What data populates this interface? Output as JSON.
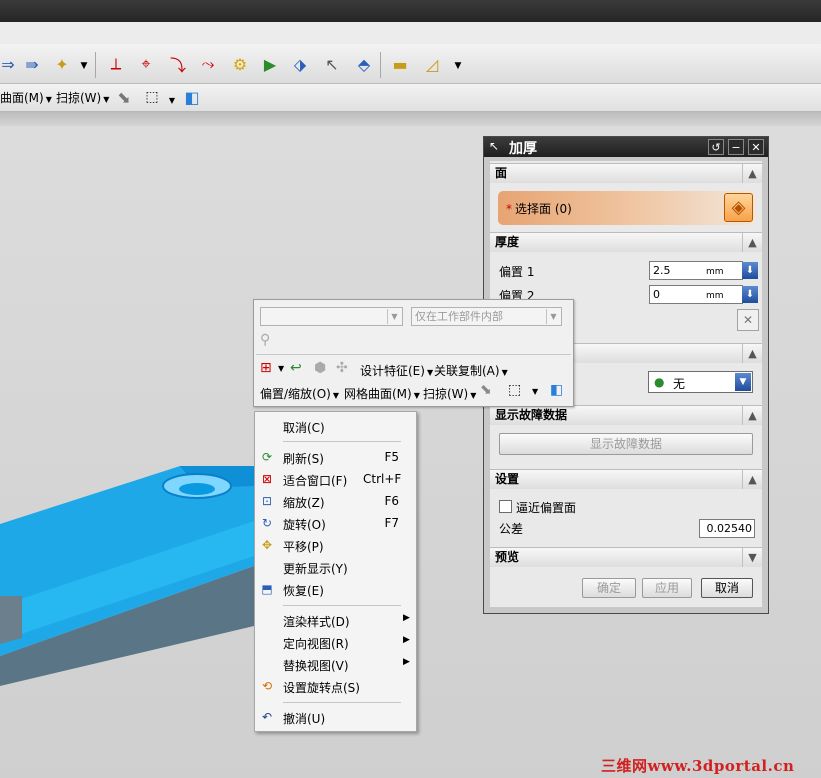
{
  "toolbar2": {
    "menus": [
      "曲面(M)",
      "扫掠(W)"
    ]
  },
  "dialog": {
    "title": "加厚",
    "title_buttons": [
      "↺",
      "−",
      "✕"
    ],
    "sections": {
      "face": {
        "header": "面",
        "select_label": "选择面 (0)"
      },
      "thickness": {
        "header": "厚度",
        "offset1_label": "偏置 1",
        "offset1_value": "2.5",
        "offset1_unit": "mm",
        "offset2_label": "偏置 2",
        "offset2_value": "0",
        "offset2_unit": "mm"
      },
      "region": {
        "combo_value": "无"
      },
      "failure": {
        "header": "显示故障数据",
        "button": "显示故障数据"
      },
      "settings": {
        "header": "设置",
        "approx_label": "逼近偏置面",
        "tolerance_label": "公差",
        "tolerance_value": "0.02540"
      },
      "preview": {
        "header": "预览"
      }
    },
    "buttons": {
      "ok": "确定",
      "apply": "应用",
      "cancel": "取消"
    }
  },
  "popup_toolbar": {
    "combo1": "",
    "combo2": "仅在工作部件内部",
    "menus_row1": [
      "设计特征(E)",
      "关联复制(A)"
    ],
    "menus_row2": [
      "偏置/缩放(O)",
      "网格曲面(M)",
      "扫掠(W)"
    ]
  },
  "context_menu": {
    "items": [
      {
        "icon": "",
        "label": "取消(C)",
        "key": "",
        "sub": false
      },
      {
        "icon": "refresh-icon",
        "label": "刷新(S)",
        "key": "F5",
        "sub": false
      },
      {
        "icon": "fit-window-icon",
        "label": "适合窗口(F)",
        "key": "Ctrl+F",
        "sub": false
      },
      {
        "icon": "zoom-icon",
        "label": "缩放(Z)",
        "key": "F6",
        "sub": false
      },
      {
        "icon": "rotate-icon",
        "label": "旋转(O)",
        "key": "F7",
        "sub": false
      },
      {
        "icon": "pan-icon",
        "label": "平移(P)",
        "key": "",
        "sub": false
      },
      {
        "icon": "",
        "label": "更新显示(Y)",
        "key": "",
        "sub": false
      },
      {
        "icon": "restore-icon",
        "label": "恢复(E)",
        "key": "",
        "sub": false
      },
      {
        "icon": "",
        "label": "渲染样式(D)",
        "key": "",
        "sub": true
      },
      {
        "icon": "",
        "label": "定向视图(R)",
        "key": "",
        "sub": true
      },
      {
        "icon": "",
        "label": "替换视图(V)",
        "key": "",
        "sub": true
      },
      {
        "icon": "rotate-point-icon",
        "label": "设置旋转点(S)",
        "key": "",
        "sub": false
      },
      {
        "icon": "undo-icon",
        "label": "撤消(U)",
        "key": "",
        "sub": false
      }
    ]
  },
  "watermark": "三维网www.3dportal.cn",
  "colors": {
    "model_blue": "#1fa8e8",
    "select_face_orange": "#e7a472",
    "title_dark": "#262626"
  }
}
